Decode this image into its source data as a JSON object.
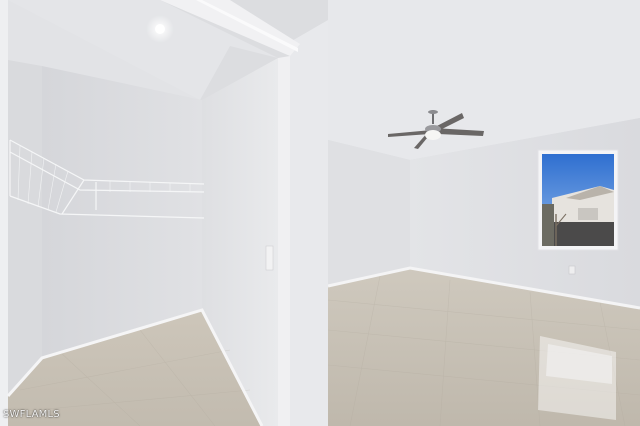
{
  "watermark": {
    "text": "SWFLAMLS"
  },
  "palette": {
    "wall_light": "#e6e7ea",
    "wall_mid": "#d7d8dc",
    "wall_shadow": "#c4c5ca",
    "ceiling": "#e9eaed",
    "floor_tile": "#c9c2b6",
    "trim": "#f3f3f4",
    "sky": "#3f7fd6"
  }
}
